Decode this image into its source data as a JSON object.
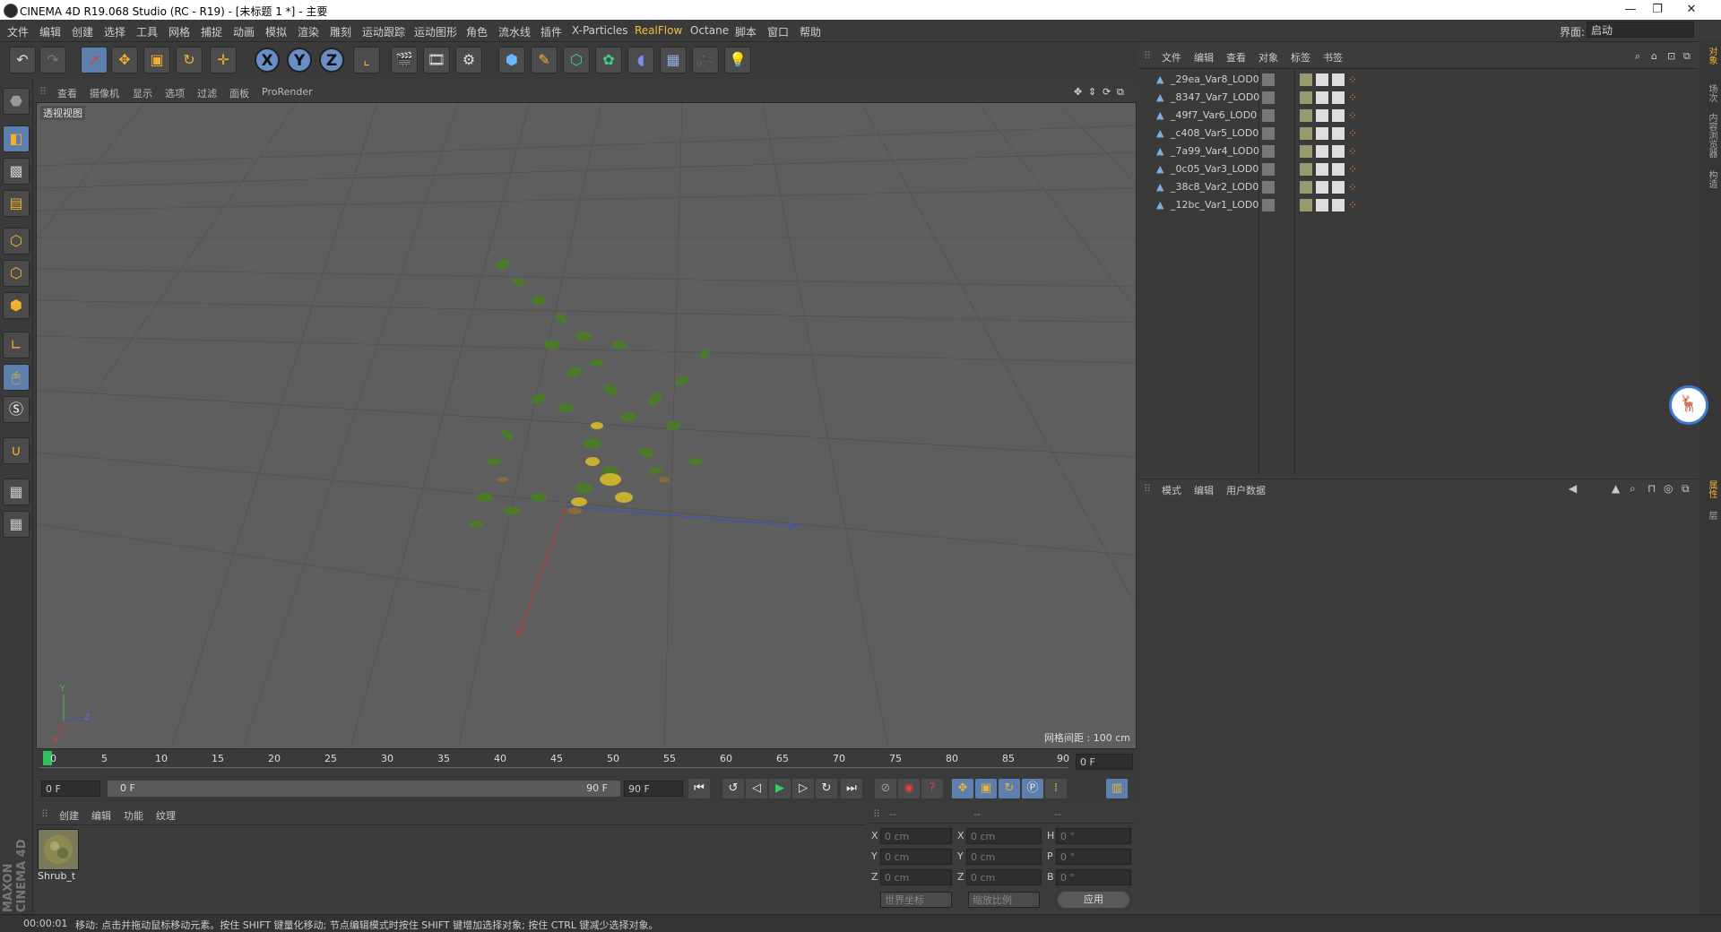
{
  "title": "CINEMA 4D R19.068 Studio (RC - R19) - [未标题 1 *] - 主要",
  "window_controls": {
    "minimize": "—",
    "maximize": "❐",
    "close": "✕"
  },
  "menubar": [
    "文件",
    "编辑",
    "创建",
    "选择",
    "工具",
    "网格",
    "捕捉",
    "动画",
    "模拟",
    "渲染",
    "雕刻",
    "运动跟踪",
    "运动图形",
    "角色",
    "流水线",
    "插件",
    "X-Particles",
    "RealFlow",
    "Octane",
    "脚本",
    "窗口",
    "帮助"
  ],
  "layout": {
    "label": "界面:",
    "value": "启动"
  },
  "viewport": {
    "menu": [
      "查看",
      "摄像机",
      "显示",
      "选项",
      "过滤",
      "面板",
      "ProRender"
    ],
    "label": "透视视图",
    "grid_info": "网格间距 : 100 cm"
  },
  "timeline": {
    "ticks": [
      "0",
      "5",
      "10",
      "15",
      "20",
      "25",
      "30",
      "35",
      "40",
      "45",
      "50",
      "55",
      "60",
      "65",
      "70",
      "75",
      "80",
      "85",
      "90"
    ],
    "current": "0 F",
    "start": "0 F",
    "range_start": "0 F",
    "range_end": "90 F",
    "end": "90 F"
  },
  "materials": {
    "menu": [
      "创建",
      "编辑",
      "功能",
      "纹理"
    ],
    "items": [
      {
        "name": "Shrub_t"
      }
    ]
  },
  "coords": {
    "headers": [
      "--",
      "--",
      "--"
    ],
    "rows": [
      {
        "a": "X",
        "av": "0 cm",
        "b": "X",
        "bv": "0 cm",
        "c": "H",
        "cv": "0 °"
      },
      {
        "a": "Y",
        "av": "0 cm",
        "b": "Y",
        "bv": "0 cm",
        "c": "P",
        "cv": "0 °"
      },
      {
        "a": "Z",
        "av": "0 cm",
        "b": "Z",
        "bv": "0 cm",
        "c": "B",
        "cv": "0 °"
      }
    ],
    "mode1": "世界坐标",
    "mode2": "缩放比例",
    "apply": "应用"
  },
  "status": {
    "time": "00:00:01",
    "message": "移动: 点击并拖动鼠标移动元素。按住 SHIFT 键量化移动; 节点编辑模式时按住 SHIFT 键增加选择对象; 按住 CTRL 键减少选择对象。"
  },
  "objects": {
    "menu": [
      "文件",
      "编辑",
      "查看",
      "对象",
      "标签",
      "书签"
    ],
    "items": [
      "_29ea_Var8_LOD0",
      "_8347_Var7_LOD0",
      "_49f7_Var6_LOD0",
      "_c408_Var5_LOD0",
      "_7a99_Var4_LOD0",
      "_0c05_Var3_LOD0",
      "_38c8_Var2_LOD0",
      "_12bc_Var1_LOD0"
    ]
  },
  "attributes": {
    "menu": [
      "模式",
      "编辑",
      "用户数据"
    ]
  },
  "right_tabs": [
    "对象",
    "场次",
    "内容浏览器",
    "构造",
    "属性",
    "层"
  ],
  "brand": "MAXON CINEMA 4D",
  "colors": {
    "accent_blue": "#5d7fae",
    "realflow": "#f0c040",
    "bg": "#3b3b3b",
    "viewport": "#5e5e5e"
  }
}
